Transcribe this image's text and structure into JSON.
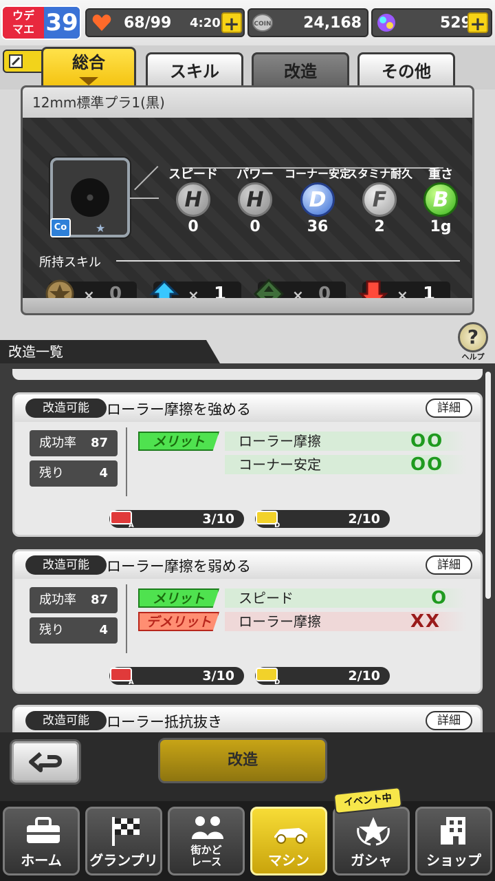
{
  "status": {
    "rank_label": "ウデマエ",
    "rank_label_line1": "ウデ",
    "rank_label_line2": "マエ",
    "rank_value": "39",
    "stamina": "68/99",
    "timer": "4:20",
    "coins": "24,168",
    "gems": "529",
    "plus": "+"
  },
  "tabs": [
    {
      "label": "総合",
      "active": true
    },
    {
      "label": "スキル",
      "active": false
    },
    {
      "label": "改造",
      "active": false
    },
    {
      "label": "その他",
      "active": false
    }
  ],
  "part": {
    "name": "12mm標準プラ1(黒)",
    "badge": "Co",
    "stats": [
      {
        "label": "スピード",
        "grade": "H",
        "value": "0"
      },
      {
        "label": "パワー",
        "grade": "H",
        "value": "0"
      },
      {
        "label": "コーナー安定",
        "grade": "D",
        "value": "36"
      },
      {
        "label": "スタミナ耐久",
        "grade": "F",
        "value": "2"
      },
      {
        "label": "重さ",
        "grade": "B",
        "value": "1g"
      }
    ],
    "skills_title": "所持スキル",
    "skills": [
      {
        "icon": "star-coin-icon",
        "x": "×",
        "count": "0"
      },
      {
        "icon": "up-arrow-icon",
        "x": "×",
        "count": "1"
      },
      {
        "icon": "diamond-arrows-icon",
        "x": "×",
        "count": "0"
      },
      {
        "icon": "down-arrow-icon",
        "x": "×",
        "count": "1"
      }
    ]
  },
  "help_label": "ヘルプ",
  "help_symbol": "?",
  "section_title": "改造一覧",
  "mods": [
    {
      "status": "改造可能",
      "title": "ローラー摩擦を強める",
      "detail": "詳細",
      "success_label": "成功率",
      "success_value": "87",
      "remain_label": "残り",
      "remain_value": "4",
      "effects": [
        {
          "tag": "メリット",
          "text": "ローラー摩擦",
          "mark": "OO"
        },
        {
          "tag": "",
          "text": "コーナー安定",
          "mark": "OO"
        }
      ],
      "materials": [
        {
          "icon": "material-a-icon",
          "count": "3/10"
        },
        {
          "icon": "material-d-icon",
          "count": "2/10"
        }
      ]
    },
    {
      "status": "改造可能",
      "title": "ローラー摩擦を弱める",
      "detail": "詳細",
      "success_label": "成功率",
      "success_value": "87",
      "remain_label": "残り",
      "remain_value": "4",
      "effects": [
        {
          "tag": "メリット",
          "text": "スピード",
          "mark": "O"
        },
        {
          "tag": "デメリット",
          "text": "ローラー摩擦",
          "mark": "XX"
        }
      ],
      "materials": [
        {
          "icon": "material-a-icon",
          "count": "3/10"
        },
        {
          "icon": "material-d-icon",
          "count": "2/10"
        }
      ]
    },
    {
      "status": "改造可能",
      "title": "ローラー抵抗抜き",
      "detail": "詳細"
    }
  ],
  "actions": {
    "modify_label": "改造"
  },
  "nav": [
    {
      "label": "ホーム",
      "icon": "toolbox-icon"
    },
    {
      "label": "グランプリ",
      "icon": "checkered-flag-icon"
    },
    {
      "label": "街かど\nレース",
      "label_line1": "街かど",
      "label_line2": "レース",
      "icon": "people-icon"
    },
    {
      "label": "マシン",
      "icon": "car-icon",
      "active": true
    },
    {
      "label": "ガシャ",
      "icon": "star-laurel-icon"
    },
    {
      "label": "ショップ",
      "icon": "shop-icon"
    }
  ],
  "event_badge": "イベント中",
  "colors": {
    "accent_yellow": "#f3c10d",
    "merit_green": "#4fe24f",
    "demerit_red": "#ff8e72",
    "rank_red": "#e8283e",
    "rank_blue": "#3a72d6"
  }
}
